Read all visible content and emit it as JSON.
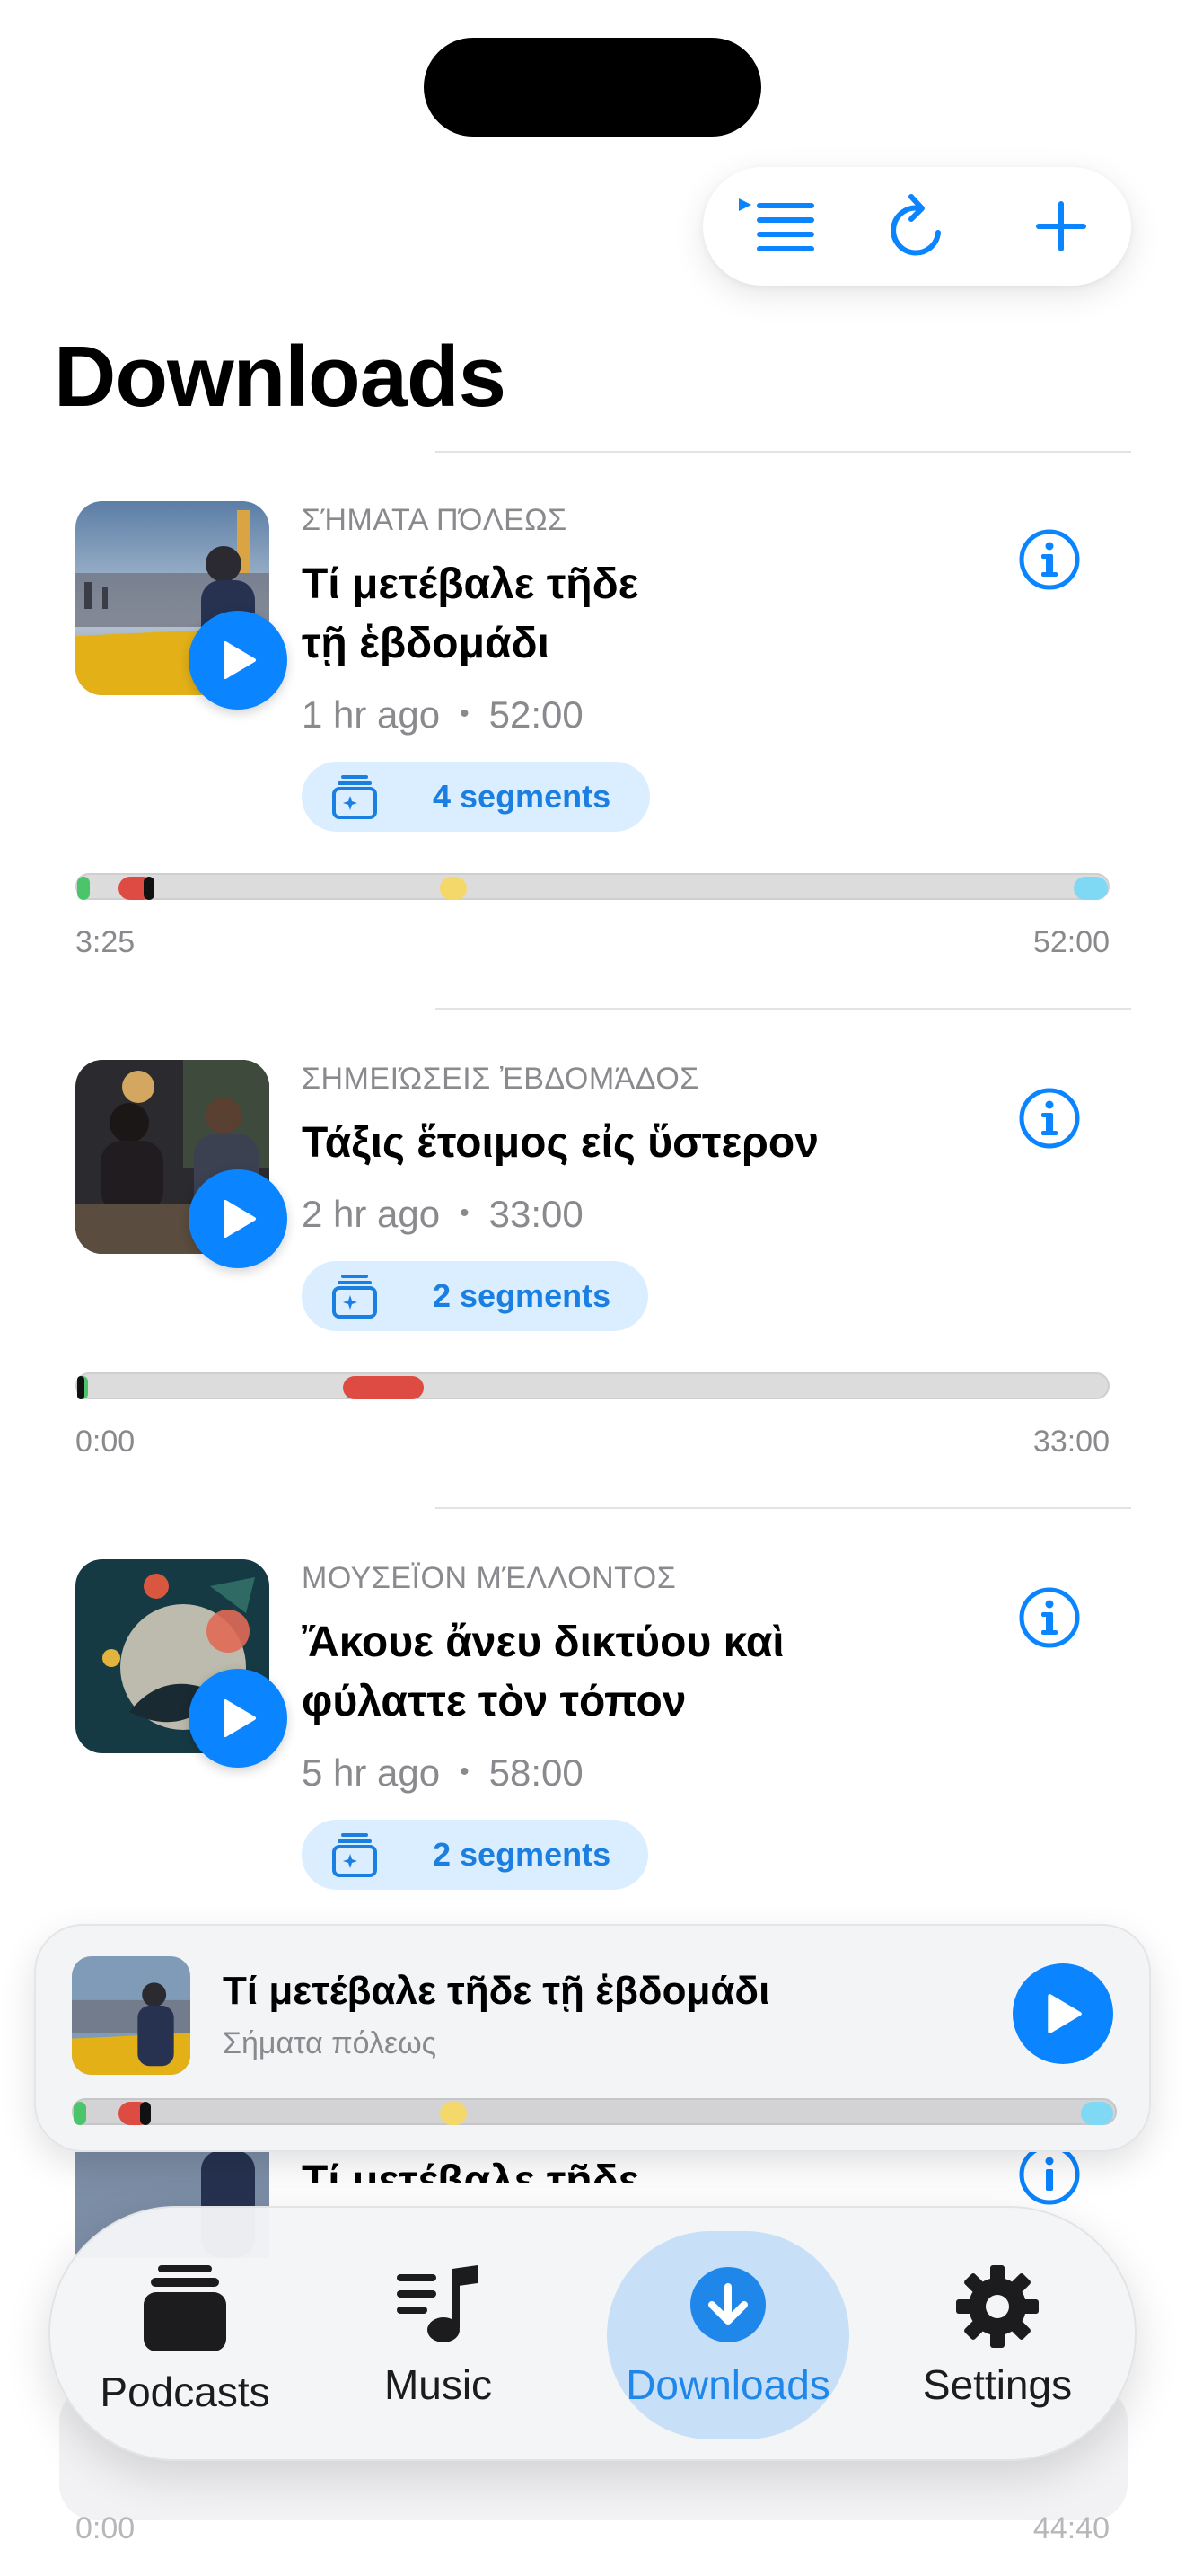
{
  "page": {
    "title": "Downloads"
  },
  "toolbar": {
    "icons": [
      "queue-list-icon",
      "refresh-icon",
      "plus-icon"
    ],
    "accent": "#0a84ff"
  },
  "episodes": [
    {
      "show": "ΣΉΜΑΤΑ ΠΌΛΕΩΣ",
      "title_line1": "Τί μετέβαλε τῆδε",
      "title_line2": "τῇ ἑβδομάδι",
      "age": "1 hr ago",
      "dot": "•",
      "duration": "52:00",
      "segments": "4 segments",
      "progress_start": "3:25",
      "progress_end": "52:00",
      "playhead_fraction": 0.066
    },
    {
      "show": "ΣΗΜΕΙΏΣΕΙΣ ἘΒΔΟΜΆΔΟΣ",
      "title_line1": "Τάξις ἕτοιμος εἰς ὕστερον",
      "title_line2": "",
      "age": "2 hr ago",
      "dot": "•",
      "duration": "33:00",
      "segments": "2 segments",
      "progress_start": "0:00",
      "progress_end": "33:00",
      "playhead_fraction": 0.0
    },
    {
      "show": "ΜΟΥΣΕΪΟΝ ΜΈΛΛΟΝΤΟΣ",
      "title_line1": "Ἄκουε ἄνευ δικτύου καὶ",
      "title_line2": "φύλαττε τὸν τόπον",
      "age": "5 hr ago",
      "dot": "•",
      "duration": "58:00",
      "segments": "2 segments"
    }
  ],
  "peek": {
    "title": "Τί μετέβαλε τῆδε",
    "progress_start": "0:00",
    "progress_end": "44:40"
  },
  "mini_player": {
    "title": "Τί μετέβαλε τῆδε τῇ ἑβδομάδι",
    "subtitle": "Σήματα πόλεως"
  },
  "tabs": [
    {
      "label": "Podcasts",
      "icon": "podcasts-stack-icon",
      "active": false
    },
    {
      "label": "Music",
      "icon": "music-note-list-icon",
      "active": false
    },
    {
      "label": "Downloads",
      "icon": "download-circle-icon",
      "active": true
    },
    {
      "label": "Settings",
      "icon": "gear-icon",
      "active": false
    }
  ],
  "colors": {
    "accent": "#0a84ff",
    "segment_green": "#4cc46a",
    "segment_red": "#de4b43",
    "segment_yellow": "#f5d86a",
    "segment_cyan": "#7fd8f4"
  }
}
